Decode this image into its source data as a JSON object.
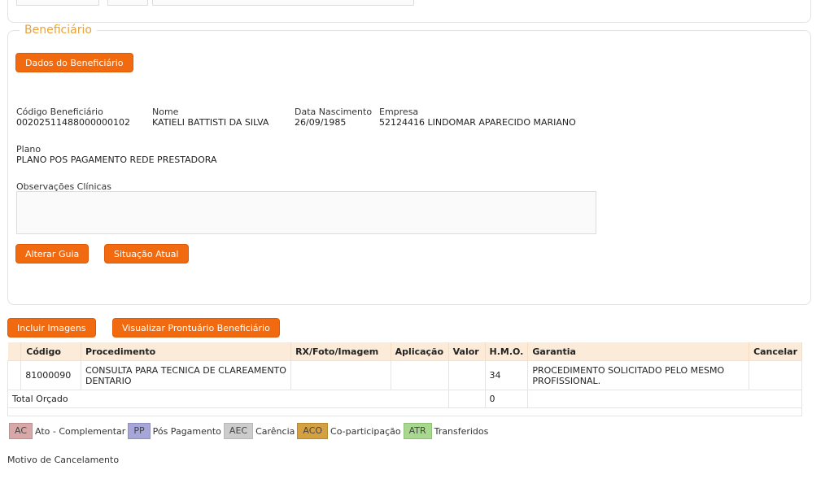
{
  "beneficiario": {
    "legend": "Beneficiário",
    "dados_button": "Dados do Beneficiário",
    "codigo_label": "Código Beneficiário",
    "codigo_value": "00202511488000000102",
    "nome_label": "Nome",
    "nome_value": "KATIELI BATTISTI DA SILVA",
    "nascimento_label": "Data Nascimento",
    "nascimento_value": "26/09/1985",
    "empresa_label": "Empresa",
    "empresa_value": "52124416 LINDOMAR APARECIDO MARIANO",
    "plano_label": "Plano",
    "plano_value": "PLANO POS PAGAMENTO REDE PRESTADORA",
    "obs_label": "Observações Clínicas",
    "obs_value": "",
    "alterar_button": "Alterar Guia",
    "situacao_button": "Situação Atual"
  },
  "actions": {
    "incluir_button": "Incluir Imagens",
    "prontuario_button": "Visualizar Prontuário Beneficiário"
  },
  "table": {
    "headers": [
      "",
      "Código",
      "Procedimento",
      "RX/Foto/Imagem",
      "Aplicação",
      "Valor",
      "H.M.O.",
      "Garantia",
      "Cancelar"
    ],
    "rows": [
      {
        "codigo": "81000090",
        "procedimento": "CONSULTA PARA TECNICA DE CLAREAMENTO DENTARIO",
        "rx": "",
        "aplicacao": "",
        "valor": "",
        "hmo": "34",
        "garantia": "PROCEDIMENTO SOLICITADO PELO MESMO PROFISSIONAL.",
        "cancelar": ""
      }
    ],
    "total_label": "Total Orçado",
    "total_hmo": "0"
  },
  "legend_items": [
    {
      "code": "AC",
      "label": "Ato - Complementar",
      "color": "#d8a8a8"
    },
    {
      "code": "PP",
      "label": "Pós Pagamento",
      "color": "#a6a6d8"
    },
    {
      "code": "AEC",
      "label": "Carência",
      "color": "#cccccc"
    },
    {
      "code": "ACO",
      "label": "Co-participação",
      "color": "#d4a040"
    },
    {
      "code": "ATR",
      "label": "Transferidos",
      "color": "#a8d890"
    }
  ],
  "motivo_label": "Motivo de Cancelamento"
}
